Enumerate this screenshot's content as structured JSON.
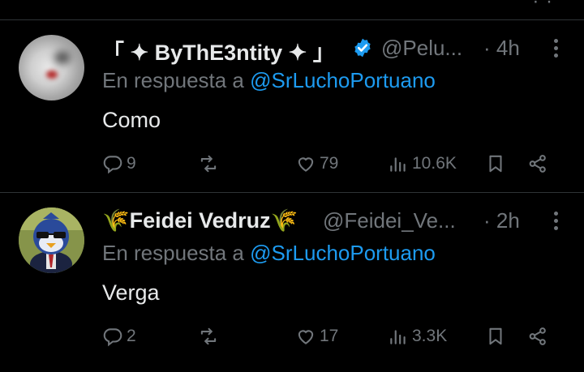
{
  "theme": {
    "bg": "#000000",
    "text": "#e7e9ea",
    "muted": "#71767b",
    "accent": "#1d9bf0",
    "divider": "#2f3336"
  },
  "top_partial": {
    "more_icon": "more-dots-icon"
  },
  "tweets": [
    {
      "display_name": "「 ✦ ByThE3ntity ✦ 」",
      "verified": true,
      "handle": "@Pelu...",
      "separator": "·",
      "time": "4h",
      "reply_prefix": "En respuesta a",
      "reply_to": "@SrLuchoPortuano",
      "text": "Como",
      "replies": "9",
      "reposts": "",
      "likes": "79",
      "views": "10.6K"
    },
    {
      "display_name": "🌾Feidei Vedruz🌾",
      "verified": false,
      "handle": "@Feidei_Ve...",
      "separator": "·",
      "time": "2h",
      "reply_prefix": "En respuesta a",
      "reply_to": "@SrLuchoPortuano",
      "text": "Verga",
      "replies": "2",
      "reposts": "",
      "likes": "17",
      "views": "3.3K"
    }
  ]
}
